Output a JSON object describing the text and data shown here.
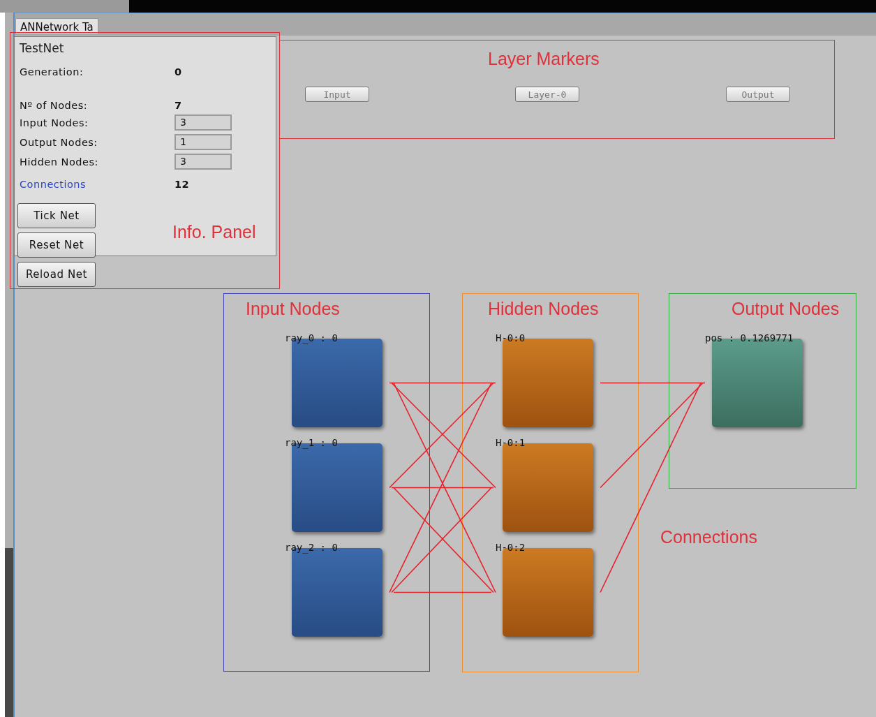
{
  "tab": {
    "label": "ANNetwork Ta"
  },
  "info_panel": {
    "title": "TestNet",
    "rows": [
      {
        "label": "Generation:",
        "value": "0",
        "kind": "text"
      },
      {
        "label": "Nº of Nodes:",
        "value": "7",
        "kind": "text"
      },
      {
        "label": "Input Nodes:",
        "value": "3",
        "kind": "field"
      },
      {
        "label": "Output Nodes:",
        "value": "1",
        "kind": "field"
      },
      {
        "label": "Hidden Nodes:",
        "value": "3",
        "kind": "field"
      },
      {
        "label": "Connections",
        "value": "12",
        "kind": "link"
      }
    ]
  },
  "buttons": [
    "Tick Net",
    "Reset Net",
    "Reload Net"
  ],
  "layer_markers": [
    "Input",
    "Layer-0",
    "Output"
  ],
  "layers": [
    {
      "kind": "input",
      "title": "Input Nodes",
      "color": "#4040c0",
      "nodes": [
        "ray_0 : 0",
        "ray_1 : 0",
        "ray_2 : 0"
      ]
    },
    {
      "kind": "hidden",
      "title": "Hidden Nodes",
      "color": "#f0902a",
      "nodes": [
        "H-0:0",
        "H-0:1",
        "H-0:2"
      ]
    },
    {
      "kind": "output",
      "title": "Output Nodes",
      "color": "#30b040",
      "nodes": [
        "pos : 0.1269771"
      ]
    }
  ],
  "annotations": [
    {
      "kind": "info",
      "text": "Info. Panel"
    },
    {
      "kind": "markers",
      "text": "Layer Markers"
    },
    {
      "kind": "connections",
      "text": "Connections"
    }
  ]
}
